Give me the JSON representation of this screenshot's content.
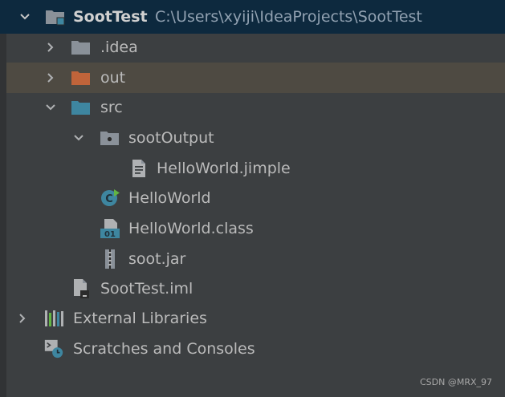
{
  "project": {
    "name": "SootTest",
    "path": "C:\\Users\\xyiji\\IdeaProjects\\SootTest"
  },
  "nodes": {
    "idea": ".idea",
    "out": "out",
    "src": "src",
    "soot_output": "sootOutput",
    "jimple_file": "HelloWorld.jimple",
    "hello_class": "HelloWorld",
    "hello_class_file": "HelloWorld.class",
    "soot_jar": "soot.jar",
    "iml_file": "SootTest.iml",
    "external_libraries": "External Libraries",
    "scratches": "Scratches and Consoles"
  },
  "watermark": "CSDN @MRX_97",
  "colors": {
    "background": "#3C3F41",
    "project_row": "#0D293E",
    "selected_row": "#4E4A42",
    "folder_gray": "#8A9199",
    "folder_orange": "#C0643A",
    "folder_blue": "#3E86A0",
    "class_blue": "#3E86A0",
    "green_accent": "#62B543",
    "text": "#BBBBBB"
  }
}
